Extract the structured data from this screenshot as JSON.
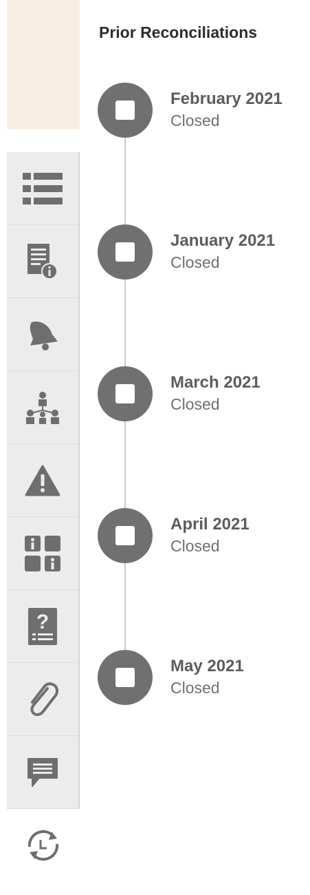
{
  "panel": {
    "title": "Prior Reconciliations"
  },
  "tabs": [
    {
      "icon": "list-icon"
    },
    {
      "icon": "document-info-icon"
    },
    {
      "icon": "bell-icon"
    },
    {
      "icon": "hierarchy-icon"
    },
    {
      "icon": "warning-icon"
    },
    {
      "icon": "grid-people-icon"
    },
    {
      "icon": "question-document-icon"
    },
    {
      "icon": "paperclip-icon"
    },
    {
      "icon": "comment-icon"
    },
    {
      "icon": "history-refresh-icon",
      "active": true
    }
  ],
  "reconciliations": [
    {
      "period": "February 2021",
      "status": "Closed"
    },
    {
      "period": "January 2021",
      "status": "Closed"
    },
    {
      "period": "March 2021",
      "status": "Closed"
    },
    {
      "period": "April 2021",
      "status": "Closed"
    },
    {
      "period": "May 2021",
      "status": "Closed"
    }
  ],
  "colors": {
    "rail_highlight": "#f8efe2",
    "tab_background": "#ececec",
    "icon": "#6e6e6e",
    "node": "#707070"
  }
}
